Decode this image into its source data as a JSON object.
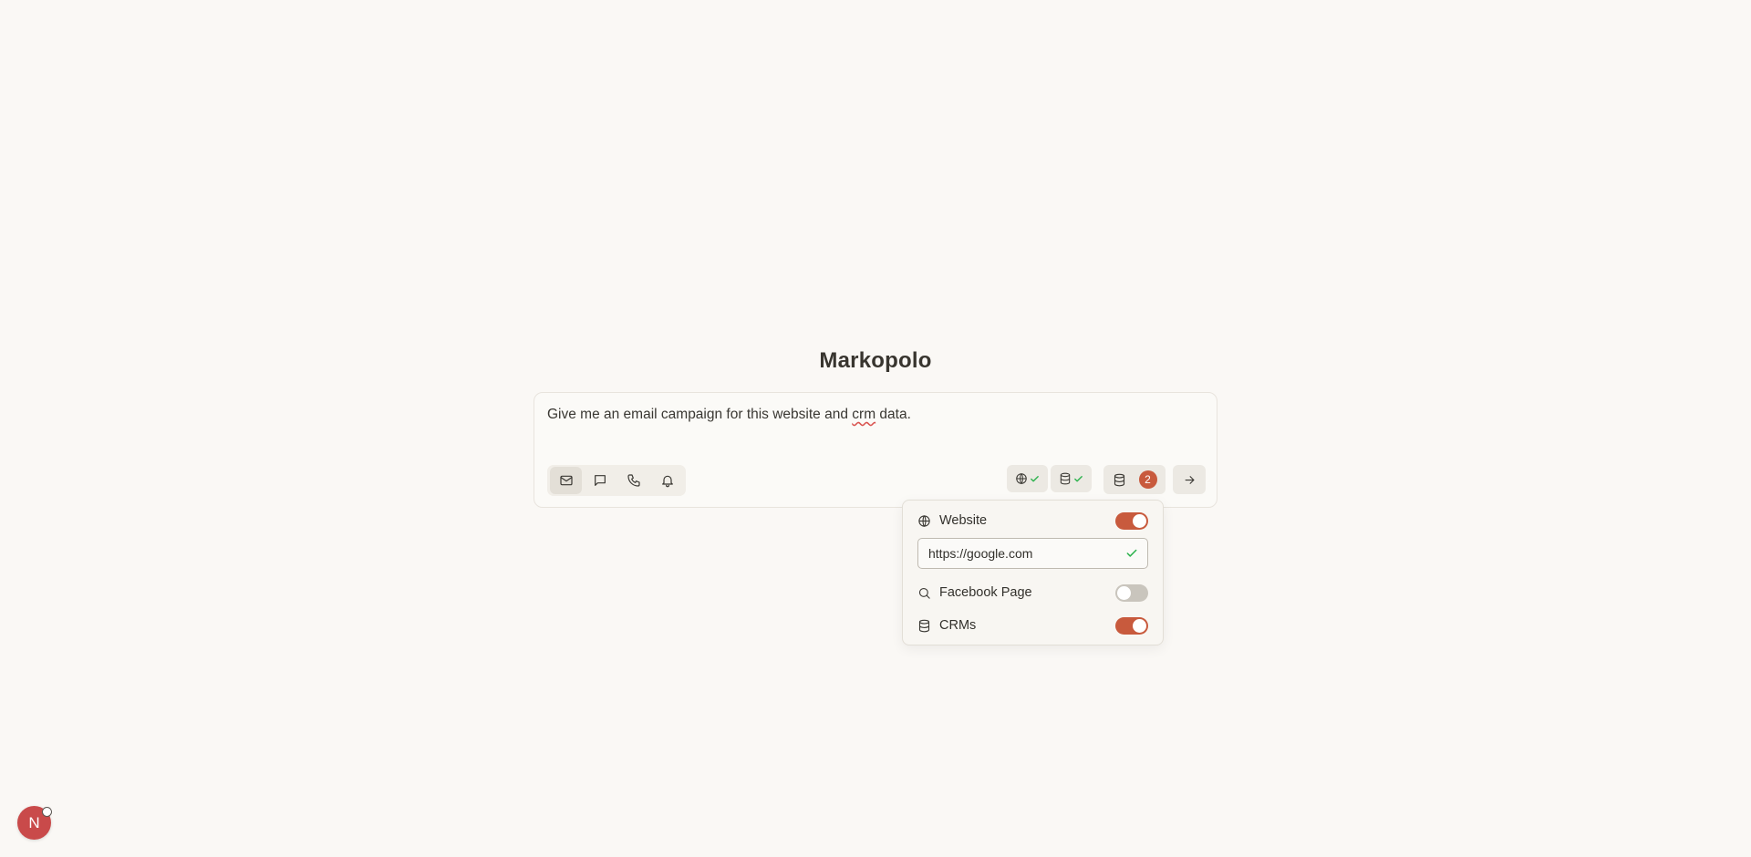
{
  "app": {
    "title": "Markopolo"
  },
  "composer": {
    "prompt_before": "Give me an email campaign for this website and ",
    "prompt_misspelled": "crm",
    "prompt_after": " data.",
    "modes": [
      {
        "name": "email",
        "icon": "mail-icon",
        "active": true
      },
      {
        "name": "message",
        "icon": "chat-bubble-icon",
        "active": false
      },
      {
        "name": "call",
        "icon": "phone-icon",
        "active": false
      },
      {
        "name": "notification",
        "icon": "bell-icon",
        "active": false
      }
    ],
    "sources": [
      {
        "icon": "globe-icon",
        "status": "connected"
      },
      {
        "icon": "database-icon",
        "status": "connected"
      }
    ],
    "crm_count": "2"
  },
  "popover": {
    "website": {
      "label": "Website",
      "icon": "globe-icon",
      "enabled": true
    },
    "url": {
      "value": "https://google.com",
      "valid": true
    },
    "facebook": {
      "label": "Facebook Page",
      "icon": "search-icon",
      "enabled": false
    },
    "crms": {
      "label": "CRMs",
      "icon": "database-icon",
      "enabled": true
    }
  },
  "user": {
    "initial": "N"
  },
  "colors": {
    "accent": "#c85a3d",
    "background": "#faf8f5",
    "success": "#2bb24c"
  }
}
